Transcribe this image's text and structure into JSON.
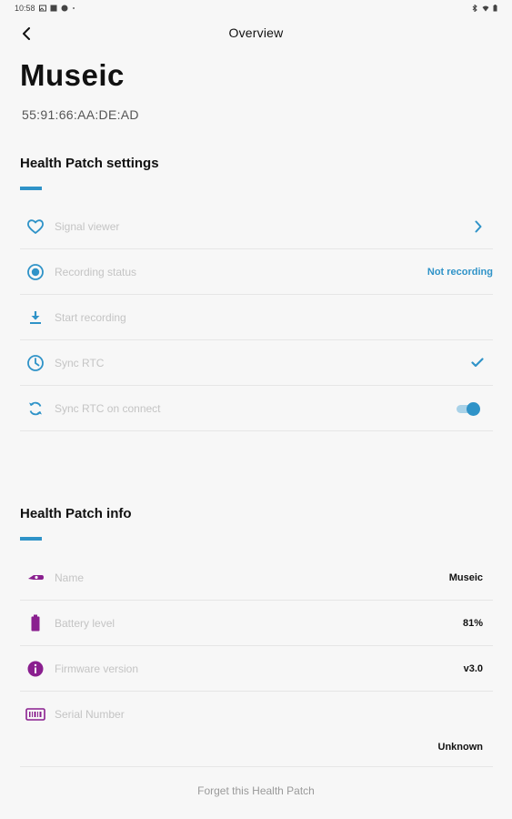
{
  "status_bar": {
    "time": "10:58",
    "icons_left": [
      "image-icon",
      "gallery-icon",
      "notification-icon",
      "dot-icon"
    ],
    "icons_right": [
      "bluetooth-icon",
      "wifi-icon",
      "battery-icon"
    ]
  },
  "app_bar": {
    "back_icon": "chevron-left-icon",
    "title": "Overview"
  },
  "device": {
    "name": "Museic",
    "mac": "55:91:66:AA:DE:AD"
  },
  "settings": {
    "title": "Health Patch settings",
    "accent_color": "#2f93c8",
    "items": [
      {
        "label": "Signal viewer",
        "icon": "heart-icon",
        "trailing": "chevron-right-icon"
      },
      {
        "label": "Recording status",
        "icon": "record-icon",
        "value": "Not recording"
      },
      {
        "label": "Start recording",
        "icon": "download-icon"
      },
      {
        "label": "Sync RTC",
        "icon": "clock-icon",
        "trailing": "check-icon"
      },
      {
        "label": "Sync RTC on connect",
        "icon": "sync-icon",
        "toggle_on": true
      }
    ]
  },
  "info": {
    "title": "Health Patch info",
    "icon_color": "#8a1f8f",
    "items": [
      {
        "label": "Name",
        "icon": "patch-icon",
        "value": "Museic"
      },
      {
        "label": "Battery level",
        "icon": "battery-icon",
        "value": "81%"
      },
      {
        "label": "Firmware version",
        "icon": "info-icon",
        "value": "v3.0"
      },
      {
        "label": "Serial Number",
        "icon": "barcode-icon",
        "value": "Unknown"
      }
    ]
  },
  "footer": {
    "forget_label": "Forget this Health Patch"
  }
}
